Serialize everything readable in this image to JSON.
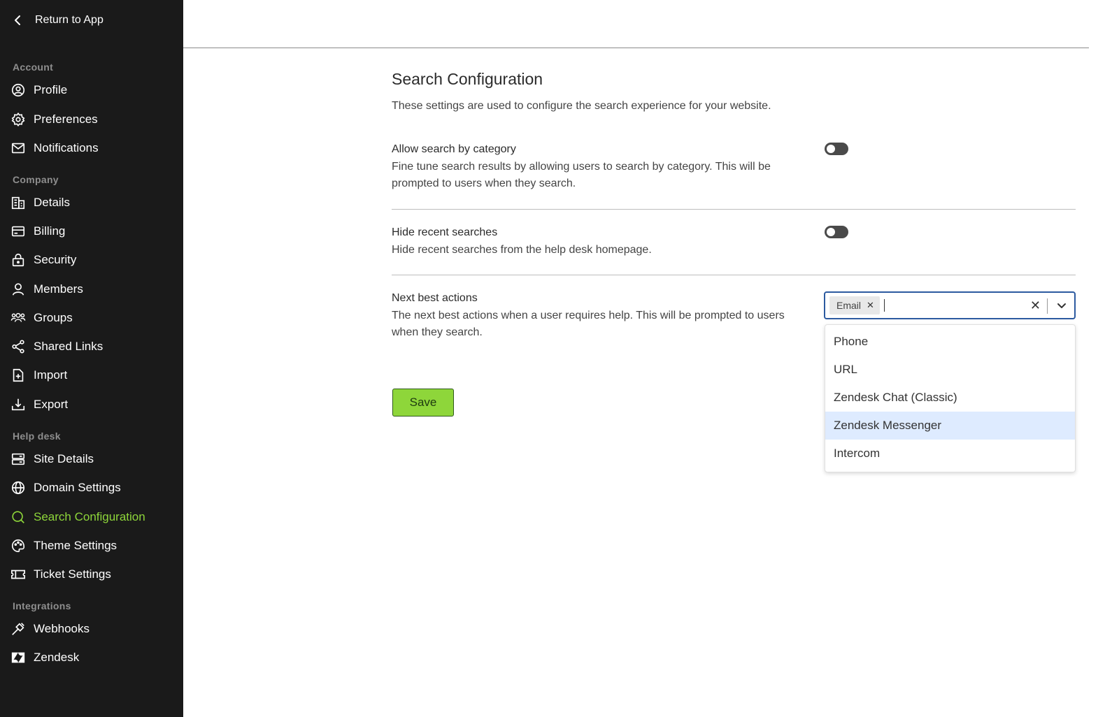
{
  "sidebar": {
    "back_label": "Return to App",
    "sections": {
      "account": "Account",
      "company": "Company",
      "help_desk": "Help desk",
      "integrations": "Integrations"
    },
    "items": {
      "profile": "Profile",
      "preferences": "Preferences",
      "notifications": "Notifications",
      "details": "Details",
      "billing": "Billing",
      "security": "Security",
      "members": "Members",
      "groups": "Groups",
      "shared_links": "Shared Links",
      "import": "Import",
      "export": "Export",
      "site_details": "Site Details",
      "domain_settings": "Domain Settings",
      "search_configuration": "Search Configuration",
      "theme_settings": "Theme Settings",
      "ticket_settings": "Ticket Settings",
      "webhooks": "Webhooks",
      "zendesk": "Zendesk"
    },
    "active_item": "search_configuration",
    "active_color": "#8ed63a"
  },
  "main": {
    "title": "Search Configuration",
    "description": "These settings are used to configure the search experience for your website.",
    "settings": {
      "category": {
        "title": "Allow search by category",
        "description": "Fine tune search results by allowing users to search by category. This will be prompted to users when they search.",
        "enabled": false
      },
      "recent": {
        "title": "Hide recent searches",
        "description": "Hide recent searches from the help desk homepage.",
        "enabled": false
      },
      "next_actions": {
        "title": "Next best actions",
        "description": "The next best actions when a user requires help. This will be prompted to users when they search.",
        "selected_chip": "Email",
        "options": [
          "Phone",
          "URL",
          "Zendesk Chat (Classic)",
          "Zendesk Messenger",
          "Intercom"
        ],
        "highlighted_option": "Zendesk Messenger"
      }
    },
    "save_label": "Save"
  }
}
